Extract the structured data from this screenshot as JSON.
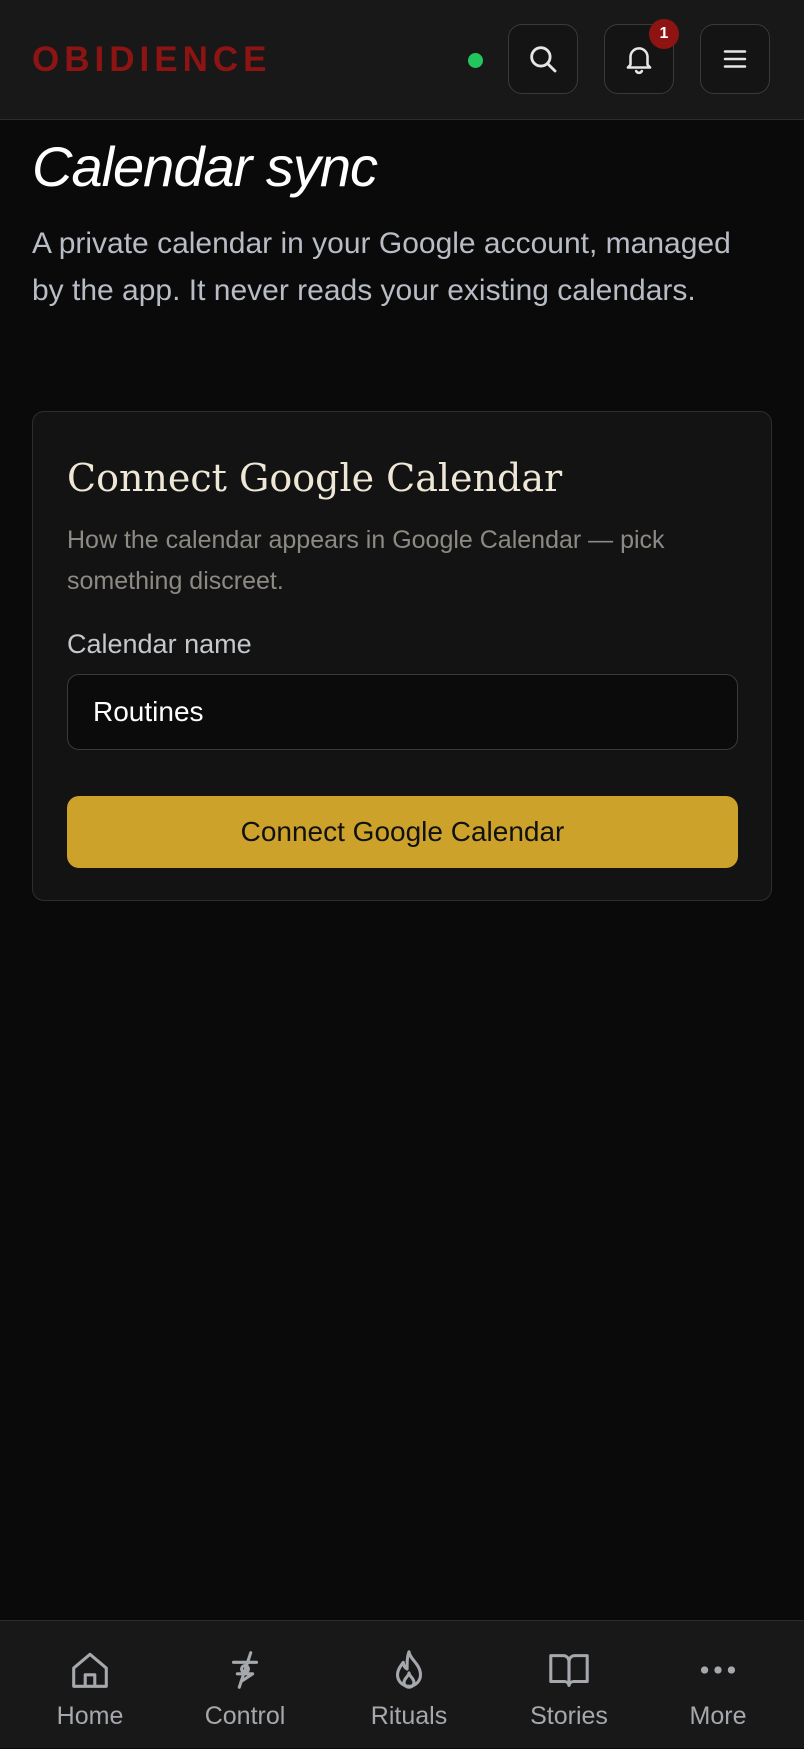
{
  "header": {
    "brand": "OBIDIENCE",
    "notification_count": "1",
    "icons": {
      "search": "search-icon",
      "notifications": "bell-icon",
      "menu": "hamburger-menu-icon"
    },
    "status_color": "#22c55e"
  },
  "page": {
    "title": "Calendar sync",
    "description": "A private calendar in your Google account, managed by the app. It never reads your existing calendars."
  },
  "card": {
    "title": "Connect Google Calendar",
    "help_text": "How the calendar appears in Google Calendar — pick something discreet.",
    "field_label": "Calendar name",
    "calendar_name_value": "Routines",
    "connect_button_label": "Connect Google Calendar"
  },
  "bottom_nav": {
    "items": [
      {
        "label": "Home",
        "icon": "home-icon"
      },
      {
        "label": "Control",
        "icon": "control-icon"
      },
      {
        "label": "Rituals",
        "icon": "flame-icon"
      },
      {
        "label": "Stories",
        "icon": "book-icon"
      },
      {
        "label": "More",
        "icon": "more-dots-icon"
      }
    ]
  },
  "colors": {
    "brand": "#8e1414",
    "accent": "#cca22a",
    "background": "#0a0a0a"
  }
}
